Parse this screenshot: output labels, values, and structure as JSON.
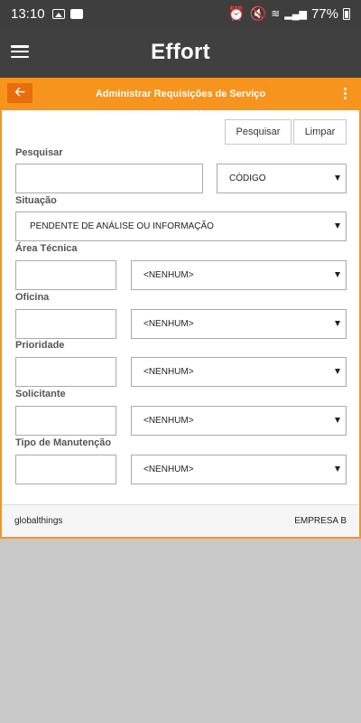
{
  "status_bar": {
    "time": "13:10",
    "battery": "77%"
  },
  "app": {
    "title": "Effort"
  },
  "panel": {
    "title": "Administrar Requisições de Serviço"
  },
  "actions": {
    "search": "Pesquisar",
    "clear": "Limpar"
  },
  "fields": {
    "search": {
      "label": "Pesquisar",
      "select_value": "CÓDIGO"
    },
    "situacao": {
      "label": "Situação",
      "select_value": "PENDENTE DE ANÁLISE OU INFORMAÇÃO"
    },
    "area_tecnica": {
      "label": "Área Técnica",
      "select_value": "<NENHUM>"
    },
    "oficina": {
      "label": "Oficina",
      "select_value": "<NENHUM>"
    },
    "prioridade": {
      "label": "Prioridade",
      "select_value": "<NENHUM>"
    },
    "solicitante": {
      "label": "Solicitante",
      "select_value": "<NENHUM>"
    },
    "tipo_manutencao": {
      "label": "Tipo de Manutenção",
      "select_value": "<NENHUM>"
    }
  },
  "footer": {
    "left": "globalthings",
    "right": "EMPRESA B"
  }
}
